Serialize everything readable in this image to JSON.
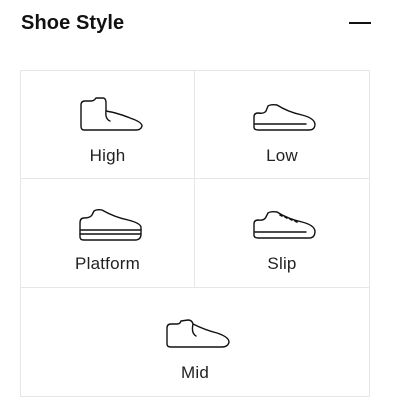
{
  "filter": {
    "title": "Shoe Style",
    "toggle_icon": "minus-icon",
    "options": [
      {
        "label": "High",
        "icon": "high-top-shoe-icon"
      },
      {
        "label": "Low",
        "icon": "low-top-shoe-icon"
      },
      {
        "label": "Platform",
        "icon": "platform-shoe-icon"
      },
      {
        "label": "Slip",
        "icon": "slip-on-shoe-icon"
      },
      {
        "label": "Mid",
        "icon": "mid-top-shoe-icon"
      }
    ]
  },
  "colors": {
    "text": "#111111",
    "border": "#e6e6e6",
    "background": "#ffffff"
  }
}
